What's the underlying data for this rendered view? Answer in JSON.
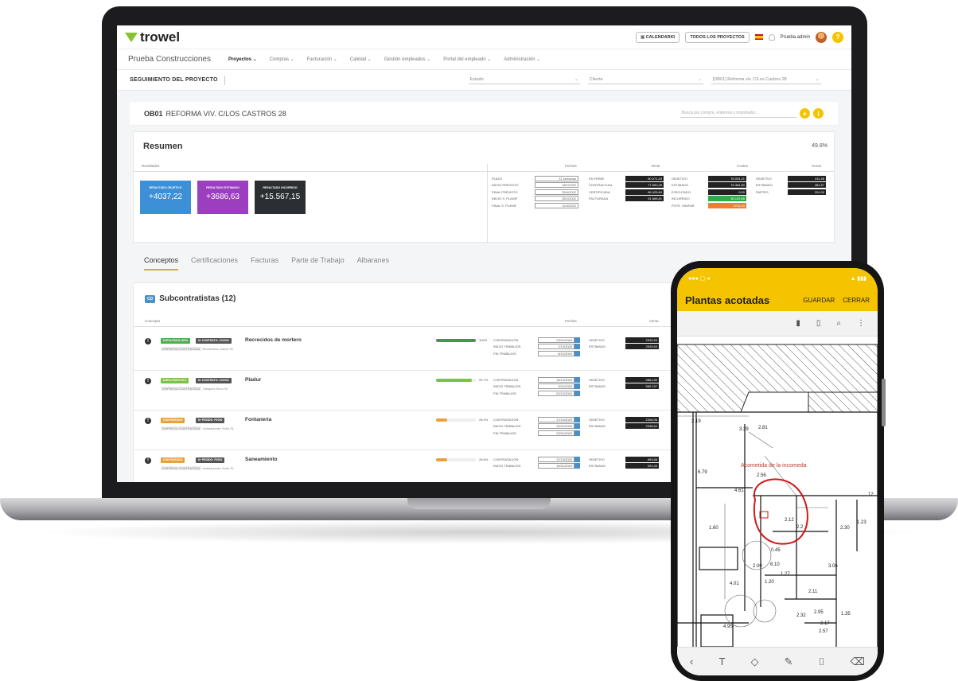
{
  "laptop": {
    "logo": "trowel",
    "topbar": {
      "calendar_btn": "CALENDARIO",
      "all_projects_btn": "TODOS LOS PROYECTOS",
      "user": "Prueba.admin",
      "help": "?"
    },
    "nav": {
      "company": "Prueba Construcciones",
      "items": [
        {
          "label": "Proyectos ⌄",
          "active": true
        },
        {
          "label": "Compras ⌄"
        },
        {
          "label": "Facturación ⌄"
        },
        {
          "label": "Calidad ⌄"
        },
        {
          "label": "Gestión empleados ⌄"
        },
        {
          "label": "Portal del empleado ⌄"
        },
        {
          "label": "Administración ⌄"
        }
      ]
    },
    "filter": {
      "title": "SEGUIMIENTO DEL PROYECTO",
      "estado": "Estado",
      "cliente": "Cliente",
      "obra": "[OB01] Reforma viv. C/Los Castros 28"
    },
    "project": {
      "code": "OB01",
      "name": "REFORMA VIV. C/LOS CASTROS 28",
      "search_placeholder": "Busca por compra, empresa o importador...",
      "add": "+",
      "info": "i"
    },
    "summary": {
      "title": "Resumen",
      "percent": "49.8%",
      "headers": {
        "resultados": "Resultados",
        "fechas": "Fechas",
        "venta": "Venta",
        "costes": "Costes",
        "horas": "Horas"
      },
      "kpis": [
        {
          "label": "RESULTADO OBJETIVO",
          "value": "+4037,22",
          "color": "#3d8fd6"
        },
        {
          "label": "RESULTADO ESTIMADO",
          "value": "+3686,63",
          "color": "#9b3fbf"
        },
        {
          "label": "RESULTADO INCURRIDO",
          "value": "+15.567,15",
          "color": "#2b2f33"
        }
      ],
      "fechas": [
        {
          "k": "PLAZO",
          "v": "11 semanas"
        },
        {
          "k": "INICIO PREVISTO",
          "v": "18/1/2022"
        },
        {
          "k": "FINAL PREVISTO",
          "v": "25/4/2022"
        },
        {
          "k": "INICIO S. PLANIF",
          "v": "26/1/2022"
        },
        {
          "k": "FINAL S. PLANIF",
          "v": "12/4/2022"
        }
      ],
      "venta": [
        {
          "k": "EN FIRME",
          "v": "80.071,43"
        },
        {
          "k": "CONTRACTUAL",
          "v": "77.590,28"
        },
        {
          "k": "CERTIFICADA",
          "v": "66.425,63"
        },
        {
          "k": "FACTURADA",
          "v": "51.668,81"
        }
      ],
      "costes": [
        {
          "k": "OBJETIVO",
          "v": "76.034,21",
          "c": "#222"
        },
        {
          "k": "ESTIMADO",
          "v": "76.384,80",
          "c": "#222"
        },
        {
          "k": "EJECUTADO",
          "v": "0,00",
          "c": "#222"
        },
        {
          "k": "INCURRIDO",
          "v": "36.101,66",
          "c": "#2eaa4a"
        },
        {
          "k": "POTE. SIN/FAR",
          "v": "3244,54",
          "c": "#f07f2a"
        }
      ],
      "horas": [
        {
          "k": "OBJETIVO",
          "v": "411,46"
        },
        {
          "k": "ESTIMADO",
          "v": "481,57"
        },
        {
          "k": "PARTES",
          "v": "324,00"
        }
      ]
    },
    "tabs": [
      "Conceptos",
      "Certificaciones",
      "Facturas",
      "Parte de Trabajo",
      "Albaranes"
    ],
    "subcontract": {
      "badge": "CD",
      "title": "Subcontratistas (12)",
      "col_concepto": "Concepto",
      "col_fechas": "Fechas",
      "col_venta": "Venta",
      "rows": [
        {
          "status": "EJECUTADO 100%",
          "status_color": "#4caf50",
          "contract": "Nº CONTRATO: C01000",
          "name": "Recrecidos de mortero",
          "company_label": "EMPRESA CONTRATADA",
          "company": "Recrecidos Juarez SL",
          "progress": 100,
          "pct": "100%",
          "bar_color": "#3a9e3e",
          "dates": [
            [
              "CONTRATACIÓN",
              "23/11/2020"
            ],
            [
              "INICIO TRABAJOS",
              "7/12/2020"
            ],
            [
              "FIN TRABAJOS",
              "8/12/2020"
            ]
          ],
          "venta": [
            [
              "OBJETIVO",
              "2929,53"
            ],
            [
              "ESTIMADO",
              "2929,53"
            ]
          ]
        },
        {
          "status": "EJECUTADO 90%",
          "status_color": "#7cc243",
          "contract": "Nº CONTRATO: C01002",
          "name": "Pladur",
          "company_label": "EMPRESA CONTRATADA",
          "company": "Tabiques Seco SL",
          "progress": 90,
          "pct": "90.7%",
          "bar_color": "#7cc243",
          "dates": [
            [
              "CONTRATACIÓN",
              "16/10/2020"
            ],
            [
              "INICIO TRABAJOS",
              "9/11/2020"
            ],
            [
              "FIN TRABAJOS",
              "22/12/2020"
            ]
          ],
          "venta": [
            [
              "OBJETIVO",
              "9861,50"
            ],
            [
              "ESTIMADO",
              "9827,57"
            ]
          ]
        },
        {
          "status": "CONTRATADO",
          "status_color": "#e9a23b",
          "contract": "Nº PEDIDO: P2000",
          "name": "Fontanería",
          "company_label": "EMPRESA CONTRATADA",
          "company": "Instalaciones Sofía SL",
          "progress": 28,
          "pct": "28.0%",
          "bar_color": "#e9a23b",
          "dates": [
            [
              "CONTRATACIÓN",
              "17/10/2020"
            ],
            [
              "INICIO TRABAJOS",
              "16/11/2020"
            ],
            [
              "FIN TRABAJOS",
              "23/11/2020"
            ]
          ],
          "venta": [
            [
              "OBJETIVO",
              "2308,96"
            ],
            [
              "ESTIMADO",
              "2338,64"
            ]
          ]
        },
        {
          "status": "CONTRATADO",
          "status_color": "#e9a23b",
          "contract": "Nº PEDIDO: P2001",
          "name": "Saneamiento",
          "company_label": "EMPRESA CONTRATADA",
          "company": "Instalaciones Sofía SL",
          "progress": 28,
          "pct": "28.6%",
          "bar_color": "#e9a23b",
          "dates": [
            [
              "CONTRATACIÓN",
              "17/10/2020"
            ],
            [
              "INICIO TRABAJOS",
              "16/11/2020"
            ]
          ],
          "venta": [
            [
              "OBJETIVO",
              "893,68"
            ],
            [
              "ESTIMADO",
              "924,33"
            ]
          ]
        }
      ]
    }
  },
  "phone": {
    "title": "Plantas acotadas",
    "save": "GUARDAR",
    "close": "CERRAR",
    "annotation": "Acometida de la incomeda",
    "dims": [
      "2.19",
      "3.29",
      "2.81",
      "6.79",
      "2.56",
      "4.61",
      "1.60",
      "2.12",
      "2.2",
      "1.23",
      "2.30",
      "2.00",
      "0.45",
      "6.10",
      "1.27",
      "4.01",
      "2.32",
      "2.95",
      "1.35",
      "2.17",
      "2.57",
      "1.20",
      "2.11",
      "4.95",
      "3.06",
      "12"
    ]
  }
}
